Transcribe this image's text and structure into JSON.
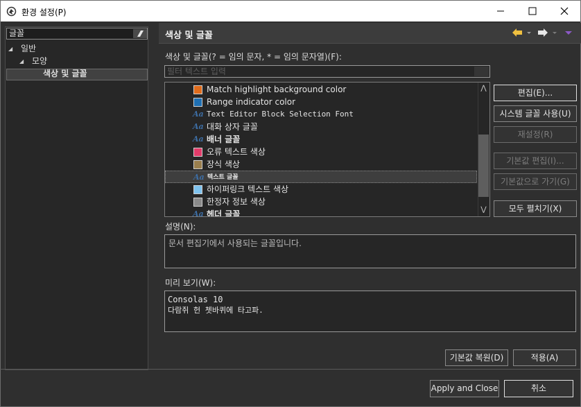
{
  "window": {
    "title": "환경 설정(P)",
    "minimize_glyph": "—",
    "maximize_glyph": "☐",
    "close_glyph": "✕"
  },
  "sidebar": {
    "filter_value": "글꼴",
    "tree": [
      {
        "label": "일반",
        "expanded": true,
        "level": 0
      },
      {
        "label": "모양",
        "expanded": true,
        "level": 1
      },
      {
        "label": "색상 및 글꼴",
        "selected": true,
        "level": 2
      }
    ]
  },
  "page": {
    "title": "색상 및 글꼴",
    "filter_label": "색상 및 글꼴(? = 임의 문자, * = 임의 문자열)(F):",
    "filter_placeholder": "필터 텍스트 입력",
    "items": [
      {
        "type": "color",
        "color": "#e06c1c",
        "label": "Match highlight background color"
      },
      {
        "type": "color",
        "color": "#1f6fb2",
        "label": "Range indicator color"
      },
      {
        "type": "font",
        "label": "Text Editor Block Selection Font",
        "mono": true
      },
      {
        "type": "font",
        "label": "대화 상자 글꼴"
      },
      {
        "type": "font",
        "label": "배너 글꼴",
        "bold": true
      },
      {
        "type": "color",
        "color": "#e23c6a",
        "label": "오류 텍스트 색상"
      },
      {
        "type": "color",
        "color": "#9a7f4e",
        "label": "장식 색상"
      },
      {
        "type": "font",
        "label": "텍스트 글꼴",
        "selected": true,
        "small": true
      },
      {
        "type": "color",
        "color": "#7fc3ef",
        "label": "하이퍼링크 텍스트 색상"
      },
      {
        "type": "color",
        "color": "#8a8a8a",
        "label": "한정자 정보 색상"
      },
      {
        "type": "font",
        "label": "헤더 글꼴",
        "bold": true
      }
    ],
    "buttons": {
      "edit": "편집(E)...",
      "use_system_font": "시스템 글꼴 사용(U)",
      "reset": "재설정(R)",
      "edit_default": "기본값 편집(I)...",
      "goto_default": "기본값으로 가기(G)",
      "expand_all": "모두 펼치기(X)"
    },
    "description_label": "설명(N):",
    "description_text": "문서 편집기에서 사용되는 글꼴입니다.",
    "preview_label": "미리 보기(W):",
    "preview_line1": "Consolas 10",
    "preview_line2": "다람쥐 헌 쳇바퀴에 타고파.",
    "restore_defaults": "기본값 복원(D)",
    "apply": "적용(A)"
  },
  "footer": {
    "apply_close": "Apply and Close",
    "cancel": "취소"
  },
  "colors": {
    "nav_arrow": "#f0c040",
    "nav_menu": "#8c59c6"
  }
}
